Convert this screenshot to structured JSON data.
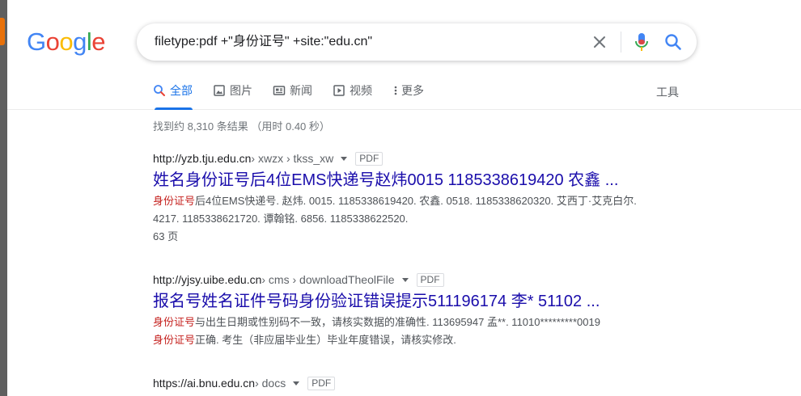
{
  "logo": {
    "text": "Google"
  },
  "search": {
    "query": "filetype:pdf +\"身份证号\" +site:\"edu.cn\""
  },
  "tabs": [
    {
      "label": "全部",
      "icon": "search-icon",
      "active": true
    },
    {
      "label": "图片",
      "icon": "image-icon",
      "active": false
    },
    {
      "label": "新闻",
      "icon": "news-icon",
      "active": false
    },
    {
      "label": "视频",
      "icon": "video-icon",
      "active": false
    },
    {
      "label": "更多",
      "icon": "more-vert-icon",
      "active": false
    }
  ],
  "tools_label": "工具",
  "stats": "找到约 8,310 条结果 （用时 0.40 秒）",
  "results": [
    {
      "url": "http://yzb.tju.edu.cn",
      "path": " › xwzx › tkss_xw",
      "badge": "PDF",
      "title": "姓名身份证号后4位EMS快递号赵炜0015 1185338619420 农鑫 ...",
      "snippet_hl": "身份证号",
      "snippet": "后4位EMS快递号. 赵炜. 0015. 1185338619420. 农鑫. 0518. 1185338620320. 艾西丁·艾克白尔. 4217. 1185338621720. 谭翰铭. 6856. 1185338622520.",
      "pages": "63 页"
    },
    {
      "url": "http://yjsy.uibe.edu.cn",
      "path": " › cms › downloadTheolFile",
      "badge": "PDF",
      "title": "报名号姓名证件号码身份验证错误提示511196174 李* 51102 ...",
      "snippet_hl": "身份证号",
      "snippet": "与出生日期或性别码不一致，请核实数据的准确性. 113695947 孟**. 11010*********0019",
      "snippet_hl2": "身份证号",
      "snippet2": "正确. 考生（非应届毕业生）毕业年度错误，请核实修改."
    },
    {
      "url": "https://ai.bnu.edu.cn",
      "path": " › docs",
      "badge": "PDF"
    }
  ]
}
